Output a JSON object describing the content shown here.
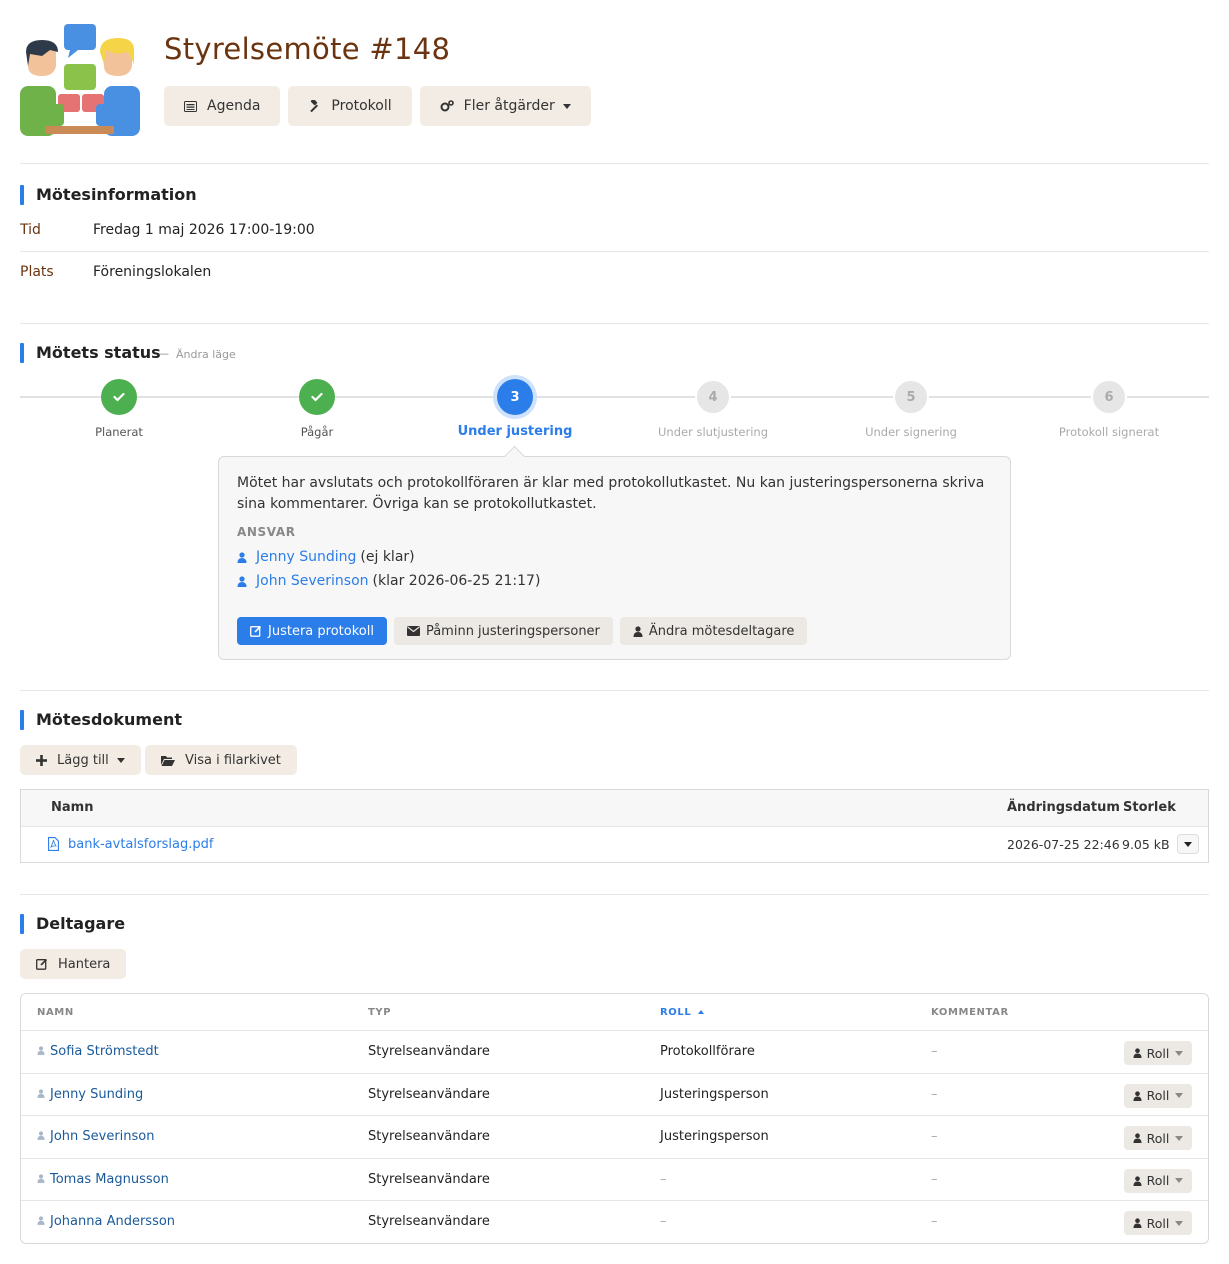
{
  "header": {
    "title": "Styrelsemöte #148",
    "buttons": {
      "agenda": "Agenda",
      "protokoll": "Protokoll",
      "more": "Fler åtgärder"
    }
  },
  "info": {
    "title": "Mötesinformation",
    "time_label": "Tid",
    "time_value": "Fredag 1 maj 2026 17:00-19:00",
    "place_label": "Plats",
    "place_value": "Föreningslokalen"
  },
  "status": {
    "title": "Mötets status",
    "dash": "—",
    "change_link": "Ändra läge",
    "steps": [
      {
        "num": "",
        "label": "Planerat",
        "state": "done"
      },
      {
        "num": "",
        "label": "Pågår",
        "state": "done"
      },
      {
        "num": "3",
        "label": "Under justering",
        "state": "active"
      },
      {
        "num": "4",
        "label": "Under slutjustering",
        "state": "pending"
      },
      {
        "num": "5",
        "label": "Under signering",
        "state": "pending"
      },
      {
        "num": "6",
        "label": "Protokoll signerat",
        "state": "pending"
      }
    ],
    "popover": {
      "description": "Mötet har avslutats och protokollföraren är klar med protokollutkastet. Nu kan justeringspersonerna skriva sina kommentarer. Övriga kan se protokollutkastet.",
      "ansvar_label": "ANSVAR",
      "people": [
        {
          "name": "Jenny Sunding",
          "note": "(ej klar)"
        },
        {
          "name": "John Severinson",
          "note": "(klar 2026-06-25 21:17)"
        }
      ],
      "buttons": {
        "justera": "Justera protokoll",
        "pamin": "Påminn justeringspersoner",
        "andra": "Ändra mötesdeltagare"
      }
    }
  },
  "documents": {
    "title": "Mötesdokument",
    "add_button": "Lägg till",
    "archive_button": "Visa i filarkivet",
    "columns": {
      "name": "Namn",
      "date": "Ändringsdatum",
      "size": "Storlek"
    },
    "rows": [
      {
        "name": "bank-avtalsforslag.pdf",
        "date": "2026-07-25 22:46",
        "size": "9.05 kB"
      }
    ]
  },
  "participants": {
    "title": "Deltagare",
    "manage_button": "Hantera",
    "columns": {
      "name": "NAMN",
      "type": "TYP",
      "role": "ROLL",
      "comment": "KOMMENTAR"
    },
    "role_button": "Roll",
    "rows": [
      {
        "name": "Sofia Strömstedt",
        "type": "Styrelseanvändare",
        "role": "Protokollförare",
        "comment": "–"
      },
      {
        "name": "Jenny Sunding",
        "type": "Styrelseanvändare",
        "role": "Justeringsperson",
        "comment": "–"
      },
      {
        "name": "John Severinson",
        "type": "Styrelseanvändare",
        "role": "Justeringsperson",
        "comment": "–"
      },
      {
        "name": "Tomas Magnusson",
        "type": "Styrelseanvändare",
        "role": "–",
        "comment": "–"
      },
      {
        "name": "Johanna Andersson",
        "type": "Styrelseanvändare",
        "role": "–",
        "comment": "–"
      }
    ]
  },
  "colors": {
    "accent": "#2b7de9",
    "title": "#6b3410",
    "success": "#4caf50",
    "button_bg": "#f3ece4"
  }
}
